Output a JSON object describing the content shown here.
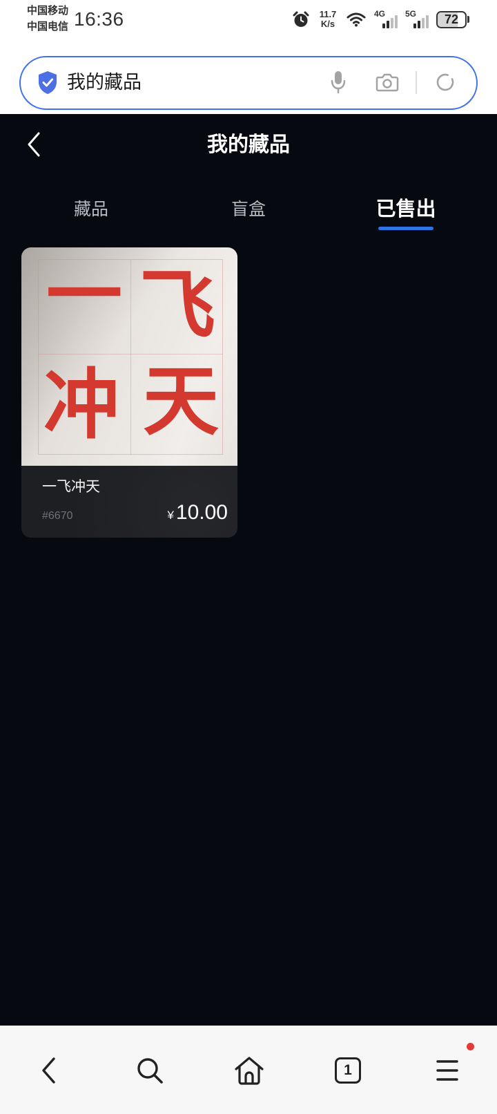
{
  "status_bar": {
    "carrier_1": "中国移动",
    "carrier_2": "中国电信",
    "time": "16:36",
    "net_speed_value": "11.7",
    "net_speed_unit": "K/s",
    "network_1": "4G",
    "network_2": "5G",
    "battery": "72",
    "icons": [
      "alarm-icon",
      "wifi-icon",
      "signal-icon",
      "battery-icon"
    ]
  },
  "search_bar": {
    "query": "我的藏品",
    "icons": [
      "shield-check-icon",
      "mic-icon",
      "camera-icon",
      "refresh-icon"
    ]
  },
  "header": {
    "title": "我的藏品",
    "back_icon": "back-icon"
  },
  "tabs": {
    "items": [
      {
        "label": "藏品"
      },
      {
        "label": "盲盒"
      },
      {
        "label": "已售出"
      }
    ],
    "active_index": 2
  },
  "collection": [
    {
      "artwork_chars": [
        "一",
        "飞",
        "冲",
        "天"
      ],
      "name": "一飞冲天",
      "serial": "#6670",
      "currency": "¥",
      "price": "10.00"
    }
  ],
  "bottom_nav": {
    "icons": [
      "back-icon",
      "search-icon",
      "home-icon",
      "tabs-icon",
      "menu-icon"
    ],
    "tab_count": "1",
    "menu_notification": true
  },
  "colors": {
    "page_bg": "#060910",
    "accent": "#2f74e6",
    "search_border": "#3f72e6",
    "shield": "#4c6fe4",
    "card_info": "#1e1f22",
    "ink": "#d4392f",
    "dot": "#e53935"
  }
}
